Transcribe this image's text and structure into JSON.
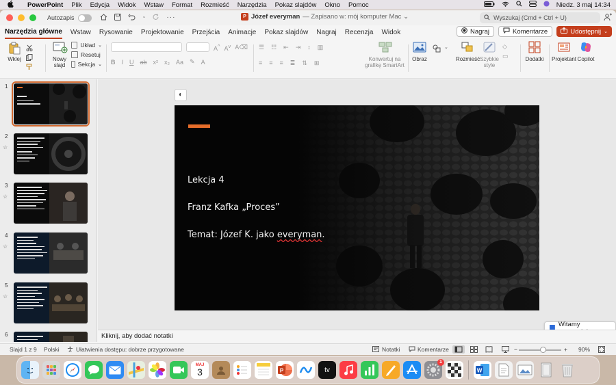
{
  "menubar": {
    "app_name": "PowerPoint",
    "items": [
      "Plik",
      "Edycja",
      "Widok",
      "Wstaw",
      "Format",
      "Rozmieść",
      "Narzędzia",
      "Pokaz slajdów",
      "Okno",
      "Pomoc"
    ],
    "clock": "Niedz. 3 maj  14:34"
  },
  "titlebar": {
    "autosave_label": "Autozapis",
    "document_name": "Józef everyman",
    "save_status": "— Zapisano w: mój komputer Mac ⌄",
    "search_placeholder": "Wyszukaj (Cmd + Ctrl + U)"
  },
  "ribbon_tabs": [
    "Narzędzia główne",
    "Wstaw",
    "Rysowanie",
    "Projektowanie",
    "Przejścia",
    "Animacje",
    "Pokaz slajdów",
    "Nagraj",
    "Recenzja",
    "Widok"
  ],
  "tab_actions": {
    "record": "Nagraj",
    "comments": "Komentarze",
    "share": "Udostępnij"
  },
  "ribbon": {
    "paste": "Wklej",
    "new_slide": "Nowy\nslajd",
    "layout": "Układ",
    "reset": "Resetuj",
    "section": "Sekcja",
    "smartart": "Konwertuj na\ngrafikę SmartArt",
    "picture": "Obraz",
    "arrange": "Rozmieść",
    "quick_styles": "Szybkie\nstyle",
    "addins": "Dodatki",
    "designer": "Projektant",
    "copilot": "Copilot"
  },
  "slide": {
    "line1": "Lekcja 4",
    "line2": "Franz Kafka „Proces”",
    "line3_prefix": "Temat: Józef K. jako ",
    "line3_word": "everyman",
    "line3_suffix": ".",
    "accent_color": "#e56d2a"
  },
  "thumbnails": [
    {
      "number": "1",
      "star": ""
    },
    {
      "number": "2",
      "star": "☆"
    },
    {
      "number": "3",
      "star": "☆"
    },
    {
      "number": "4",
      "star": "☆"
    },
    {
      "number": "5",
      "star": "☆"
    },
    {
      "number": "6",
      "star": "☆"
    }
  ],
  "welcome_toast": "Witamy ponownie!",
  "notes_placeholder": "Kliknij, aby dodać notatki",
  "statusbar": {
    "slide_counter": "Slajd 1 z 9",
    "language": "Polski",
    "accessibility": "Ułatwienia dostępu: dobrze przygotowane",
    "notes": "Notatki",
    "comments": "Komentarze",
    "zoom": "90%"
  },
  "dock": {
    "calendar_month": "MAJ",
    "calendar_day": "3",
    "settings_badge": "1",
    "appletv_label": "tv"
  }
}
